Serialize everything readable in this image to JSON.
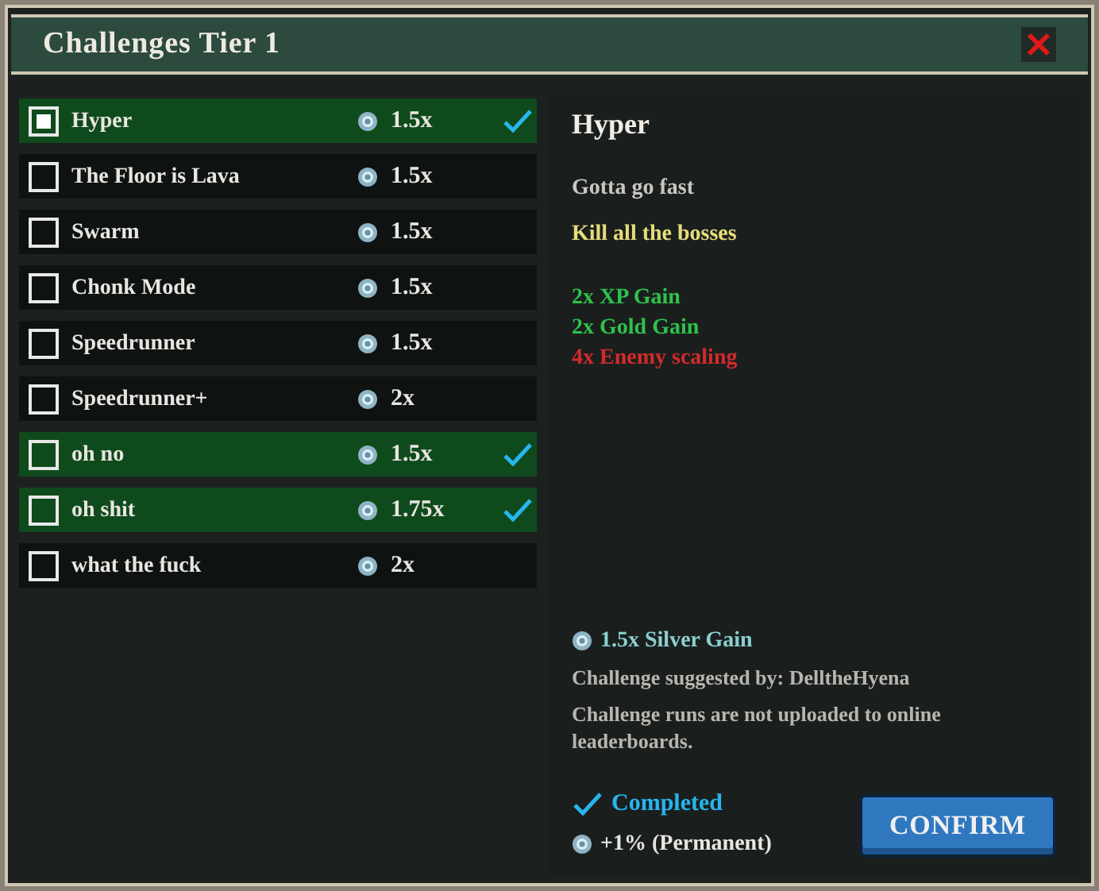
{
  "window": {
    "title": "Challenges Tier 1"
  },
  "challenges": [
    {
      "name": "Hyper",
      "multiplier": "1.5x",
      "selected": true,
      "completed": true
    },
    {
      "name": "The Floor is Lava",
      "multiplier": "1.5x",
      "selected": false,
      "completed": false
    },
    {
      "name": "Swarm",
      "multiplier": "1.5x",
      "selected": false,
      "completed": false
    },
    {
      "name": "Chonk Mode",
      "multiplier": "1.5x",
      "selected": false,
      "completed": false
    },
    {
      "name": "Speedrunner",
      "multiplier": "1.5x",
      "selected": false,
      "completed": false
    },
    {
      "name": "Speedrunner+",
      "multiplier": "2x",
      "selected": false,
      "completed": false
    },
    {
      "name": "oh no",
      "multiplier": "1.5x",
      "selected": false,
      "completed": true
    },
    {
      "name": "oh shit",
      "multiplier": "1.75x",
      "selected": false,
      "completed": true
    },
    {
      "name": "what the fuck",
      "multiplier": "2x",
      "selected": false,
      "completed": false
    }
  ],
  "detail": {
    "title": "Hyper",
    "description": "Gotta go fast",
    "objective": "Kill all the bosses",
    "effects": [
      {
        "text": "2x XP Gain",
        "color": "#2fc24a"
      },
      {
        "text": "2x Gold Gain",
        "color": "#2fc24a"
      },
      {
        "text": "4x Enemy scaling",
        "color": "#d42a2a"
      }
    ],
    "reward": "1.5x Silver Gain",
    "suggested_by": "Challenge suggested by: DelltheHyena",
    "notice": "Challenge runs are not uploaded to online leaderboards.",
    "completed": true,
    "status": "Completed",
    "bonus": "+1% (Permanent)",
    "confirm": "CONFIRM"
  }
}
